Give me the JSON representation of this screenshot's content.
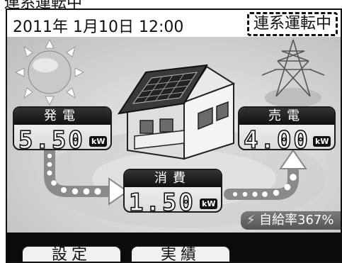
{
  "status": {
    "datetime": "2011年 1月10日 12:00",
    "mode": "連系運転中"
  },
  "generation": {
    "title": "発電",
    "value": "5.50",
    "unit": "kW"
  },
  "selling": {
    "title": "売電",
    "value": "4.00",
    "unit": "kW"
  },
  "consumption": {
    "title": "消費",
    "value": "1.50",
    "unit": "kW"
  },
  "self_sufficiency": {
    "label": "自給率",
    "value": "367%"
  },
  "tabs": [
    {
      "label": "設定"
    },
    {
      "label": "実績"
    }
  ],
  "colors": {
    "panel_header": "#111111",
    "background": "#d9d9d9",
    "arrow": "#ffffff"
  },
  "icons": {
    "sun": "sun-icon",
    "house": "house-with-solar-panels-icon",
    "tower": "power-tower-icon",
    "lightning": "lightning-icon"
  }
}
